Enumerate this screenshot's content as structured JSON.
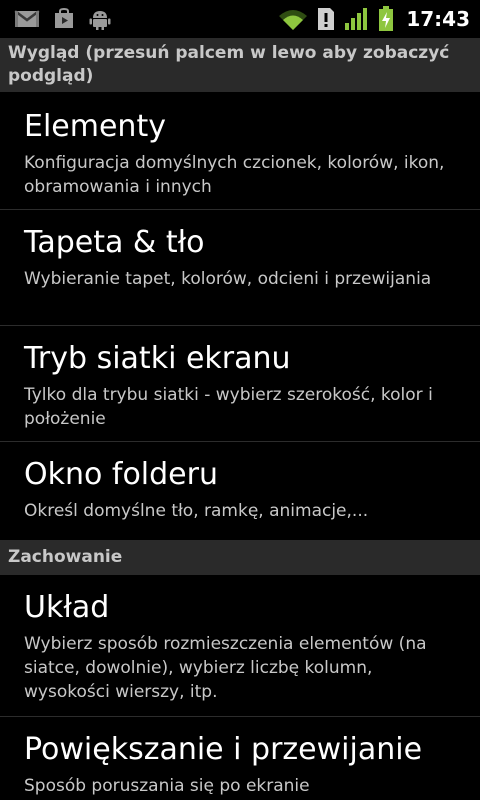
{
  "status_bar": {
    "icons_left": [
      "gmail-icon",
      "play-store-icon",
      "android-debug-icon"
    ],
    "icons_right": [
      "wifi-icon",
      "alert-icon",
      "signal-icon",
      "battery-charging-icon"
    ],
    "time": "17:43",
    "accent": "#8ec63f"
  },
  "sections": [
    {
      "header": "Wygląd (przesuń palcem w lewo aby zobaczyć podgląd)",
      "items": [
        {
          "title": "Elementy",
          "summary": "Konfiguracja domyślnych czcionek, kolorów, ikon, obramowania i innych"
        },
        {
          "title": "Tapeta & tło",
          "summary": "Wybieranie tapet, kolorów, odcieni i przewijania"
        },
        {
          "title": "Tryb siatki ekranu",
          "summary": "Tylko dla trybu siatki - wybierz szerokość, kolor i położenie"
        },
        {
          "title": "Okno folderu",
          "summary": "Określ domyślne tło, ramkę, animacje,..."
        }
      ]
    },
    {
      "header": "Zachowanie",
      "items": [
        {
          "title": "Układ",
          "summary": "Wybierz sposób rozmieszczenia elementów (na siatce, dowolnie), wybierz liczbę kolumn, wysokości wierszy, itp."
        },
        {
          "title": "Powiększanie i przewijanie",
          "summary": "Sposób poruszania się po ekranie"
        }
      ]
    }
  ]
}
